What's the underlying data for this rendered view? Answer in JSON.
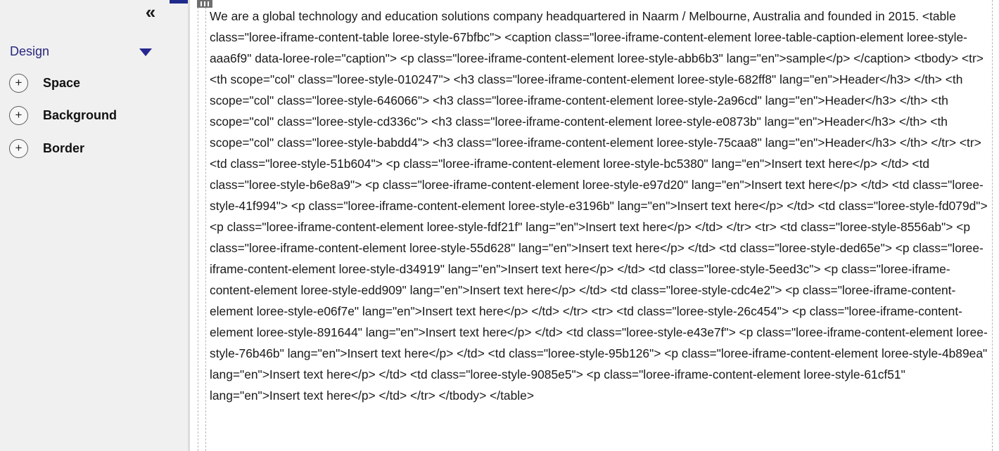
{
  "sidebar": {
    "collapse_icon": "«",
    "section_title": "Design",
    "items": [
      {
        "label": "Space",
        "icon": "plus-circle"
      },
      {
        "label": "Background",
        "icon": "plus-circle"
      },
      {
        "label": "Border",
        "icon": "plus-circle"
      }
    ]
  },
  "colors": {
    "accent": "#26278f",
    "sidebar_bg": "#f0f0f1"
  },
  "editor": {
    "content": "We are a global technology and education solutions company headquartered in Naarm / Melbourne, Australia and founded in 2015. <table class=\"loree-iframe-content-table loree-style-67bfbc\"> <caption class=\"loree-iframe-content-element loree-table-caption-element loree-style-aaa6f9\" data-loree-role=\"caption\"> <p class=\"loree-iframe-content-element loree-style-abb6b3\" lang=\"en\">sample</p> </caption> <tbody> <tr> <th scope=\"col\" class=\"loree-style-010247\"> <h3 class=\"loree-iframe-content-element loree-style-682ff8\" lang=\"en\">Header</h3> </th> <th scope=\"col\" class=\"loree-style-646066\"> <h3 class=\"loree-iframe-content-element loree-style-2a96cd\" lang=\"en\">Header</h3> </th> <th scope=\"col\" class=\"loree-style-cd336c\"> <h3 class=\"loree-iframe-content-element loree-style-e0873b\" lang=\"en\">Header</h3> </th> <th scope=\"col\" class=\"loree-style-babdd4\"> <h3 class=\"loree-iframe-content-element loree-style-75caa8\" lang=\"en\">Header</h3> </th> </tr> <tr> <td class=\"loree-style-51b604\"> <p class=\"loree-iframe-content-element loree-style-bc5380\" lang=\"en\">Insert text here</p> </td> <td class=\"loree-style-b6e8a9\"> <p class=\"loree-iframe-content-element loree-style-e97d20\" lang=\"en\">Insert text here</p> </td> <td class=\"loree-style-41f994\"> <p class=\"loree-iframe-content-element loree-style-e3196b\" lang=\"en\">Insert text here</p> </td> <td class=\"loree-style-fd079d\"> <p class=\"loree-iframe-content-element loree-style-fdf21f\" lang=\"en\">Insert text here</p> </td> </tr> <tr> <td class=\"loree-style-8556ab\"> <p class=\"loree-iframe-content-element loree-style-55d628\" lang=\"en\">Insert text here</p> </td> <td class=\"loree-style-ded65e\"> <p class=\"loree-iframe-content-element loree-style-d34919\" lang=\"en\">Insert text here</p> </td> <td class=\"loree-style-5eed3c\"> <p class=\"loree-iframe-content-element loree-style-edd909\" lang=\"en\">Insert text here</p> </td> <td class=\"loree-style-cdc4e2\"> <p class=\"loree-iframe-content-element loree-style-e06f7e\" lang=\"en\">Insert text here</p> </td> </tr> <tr> <td class=\"loree-style-26c454\"> <p class=\"loree-iframe-content-element loree-style-891644\" lang=\"en\">Insert text here</p> </td> <td class=\"loree-style-e43e7f\"> <p class=\"loree-iframe-content-element loree-style-76b46b\" lang=\"en\">Insert text here</p> </td> <td class=\"loree-style-95b126\"> <p class=\"loree-iframe-content-element loree-style-4b89ea\" lang=\"en\">Insert text here</p> </td> <td class=\"loree-style-9085e5\"> <p class=\"loree-iframe-content-element loree-style-61cf51\" lang=\"en\">Insert text here</p> </td> </tr> </tbody> </table>"
  }
}
